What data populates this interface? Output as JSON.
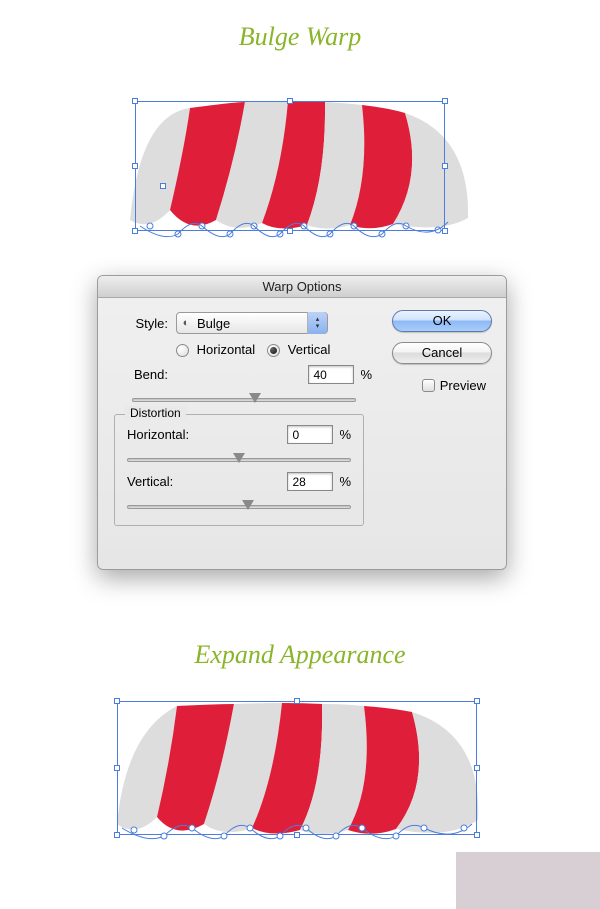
{
  "headings": {
    "bulge": "Bulge Warp",
    "expand": "Expand Appearance"
  },
  "dialog": {
    "title": "Warp Options",
    "style_label": "Style:",
    "style_value": "Bulge",
    "orient": {
      "horizontal": "Horizontal",
      "vertical": "Vertical",
      "checked": "vertical"
    },
    "bend_label": "Bend:",
    "bend_value": "40",
    "percent": "%",
    "distortion": {
      "legend": "Distortion",
      "h_label": "Horizontal:",
      "h_value": "0",
      "v_label": "Vertical:",
      "v_value": "28"
    },
    "buttons": {
      "ok": "OK",
      "cancel": "Cancel"
    },
    "preview": {
      "label": "Preview",
      "checked": false
    }
  },
  "chart_data": {
    "type": "illustration",
    "note": "Awning graphic with bounding box; not a data chart."
  }
}
